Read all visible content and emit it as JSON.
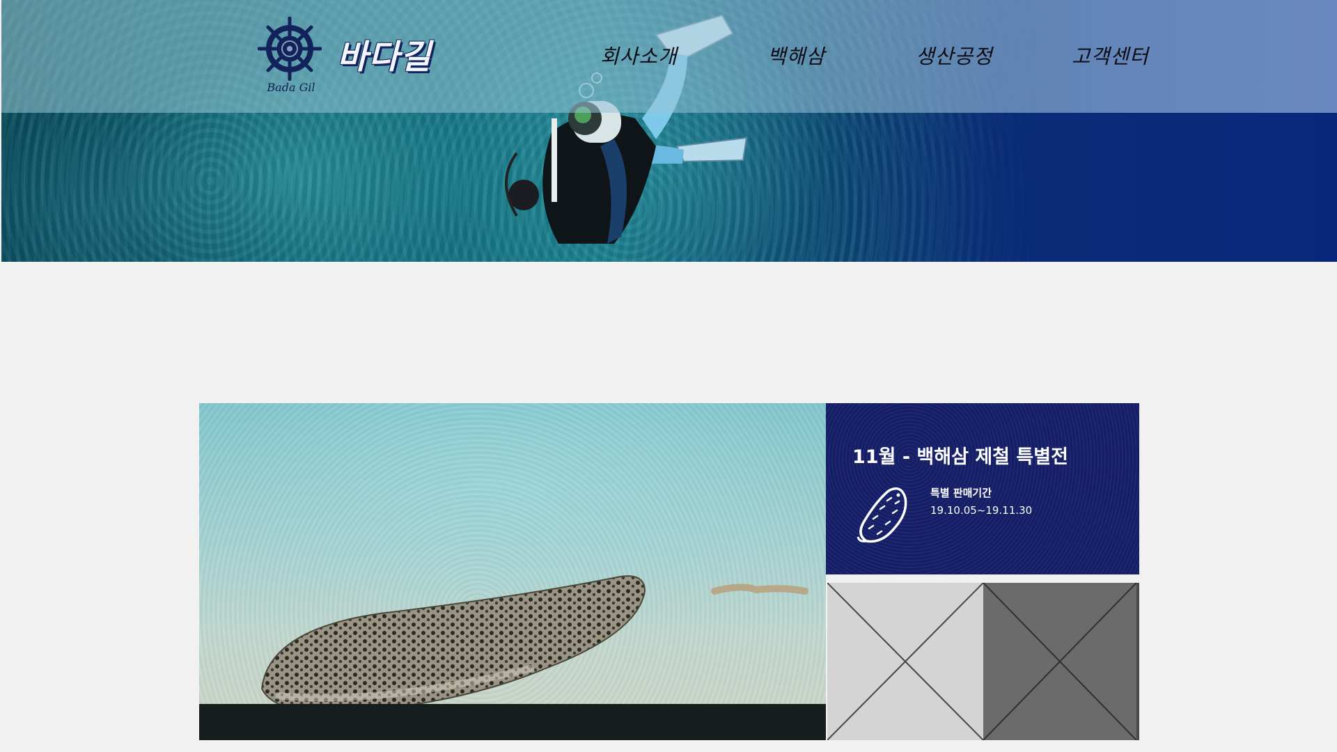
{
  "brand": {
    "logo_icon": "ship-wheel-icon",
    "title": "바다길",
    "subtitle": "Bada Gil",
    "color": "#16206a"
  },
  "nav": {
    "items": [
      {
        "label": "회사소개"
      },
      {
        "label": "백해삼"
      },
      {
        "label": "생산공정"
      },
      {
        "label": "고객센터"
      }
    ]
  },
  "hero": {
    "image": "scuba-diver-coral-reef"
  },
  "feature": {
    "image": "sea-cucumber-on-sand"
  },
  "promo": {
    "title": "11월 - 백해삼 제철 특별전",
    "icon": "sea-cucumber-icon",
    "period_label": "특별 판매기간",
    "period_dates": "19.10.05~19.11.30",
    "background": "#16206a"
  },
  "placeholders": [
    {
      "type": "image-placeholder",
      "tone": "light"
    },
    {
      "type": "image-placeholder",
      "tone": "dark"
    }
  ]
}
